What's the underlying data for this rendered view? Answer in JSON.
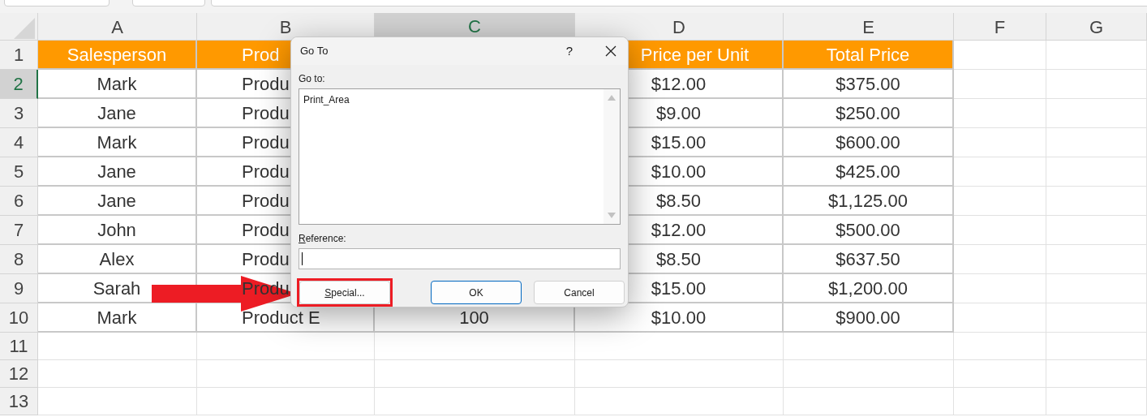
{
  "columns": [
    {
      "label": "A",
      "selected": false
    },
    {
      "label": "B",
      "selected": false
    },
    {
      "label": "C",
      "selected": true
    },
    {
      "label": "D",
      "selected": false
    },
    {
      "label": "E",
      "selected": false
    },
    {
      "label": "F",
      "selected": false
    },
    {
      "label": "G",
      "selected": false
    }
  ],
  "rows": [
    {
      "number": "1",
      "selected": false,
      "kind": "header",
      "cells": {
        "A": "Salesperson",
        "B": "Prod",
        "D": "Price per Unit",
        "E": "Total Price"
      }
    },
    {
      "number": "2",
      "selected": true,
      "kind": "data",
      "cells": {
        "A": "Mark",
        "B": "Produ",
        "D": "$12.00",
        "E": "$375.00"
      }
    },
    {
      "number": "3",
      "selected": false,
      "kind": "data",
      "cells": {
        "A": "Jane",
        "B": "Produ",
        "D": "$9.00",
        "E": "$250.00"
      }
    },
    {
      "number": "4",
      "selected": false,
      "kind": "data",
      "cells": {
        "A": "Mark",
        "B": "Produ",
        "D": "$15.00",
        "E": "$600.00"
      }
    },
    {
      "number": "5",
      "selected": false,
      "kind": "data",
      "cells": {
        "A": "Jane",
        "B": "Produ",
        "D": "$10.00",
        "E": "$425.00"
      }
    },
    {
      "number": "6",
      "selected": false,
      "kind": "data",
      "cells": {
        "A": "Jane",
        "B": "Produ",
        "D": "$8.50",
        "E": "$1,125.00"
      }
    },
    {
      "number": "7",
      "selected": false,
      "kind": "data",
      "cells": {
        "A": "John",
        "B": "Produ",
        "D": "$12.00",
        "E": "$500.00"
      }
    },
    {
      "number": "8",
      "selected": false,
      "kind": "data",
      "cells": {
        "A": "Alex",
        "B": "Produ",
        "D": "$8.50",
        "E": "$637.50"
      }
    },
    {
      "number": "9",
      "selected": false,
      "kind": "data",
      "cells": {
        "A": "Sarah",
        "B": "Produ",
        "D": "$15.00",
        "E": "$1,200.00"
      }
    },
    {
      "number": "10",
      "selected": false,
      "kind": "data",
      "cells": {
        "A": "Mark",
        "B": "Product E",
        "C": "100",
        "D": "$10.00",
        "E": "$900.00"
      }
    },
    {
      "number": "11",
      "selected": false,
      "kind": "empty"
    },
    {
      "number": "12",
      "selected": false,
      "kind": "empty"
    },
    {
      "number": "13",
      "selected": false,
      "kind": "empty"
    }
  ],
  "dialog": {
    "title": "Go To",
    "help": "?",
    "goto_label": "Go to:",
    "goto_items": [
      {
        "label": "Print_Area",
        "selected": false
      }
    ],
    "reference_label": "Reference:",
    "buttons": [
      {
        "label": "Special...",
        "highlighted": true,
        "default": false
      },
      {
        "label": "OK",
        "highlighted": false,
        "default": true
      },
      {
        "label": "Cancel",
        "highlighted": false,
        "default": false
      }
    ]
  }
}
